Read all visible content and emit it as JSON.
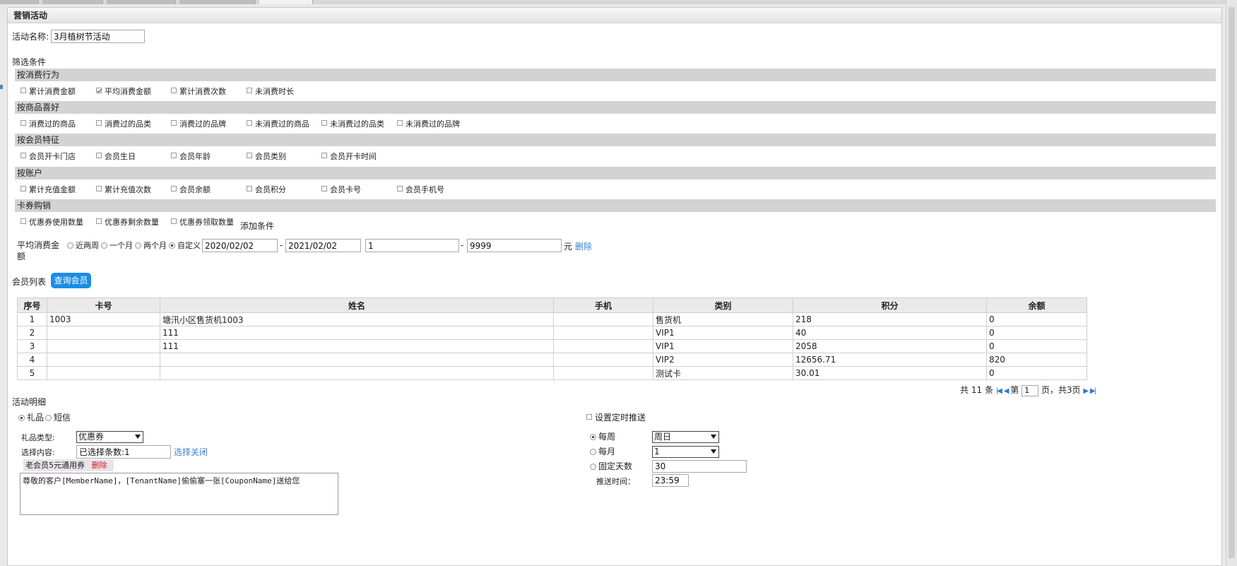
{
  "panel_title": "营销活动",
  "activity_name": {
    "label": "活动名称:",
    "value": "3月植树节活动"
  },
  "filter_title": "筛选条件",
  "sections": [
    {
      "title": "按消费行为",
      "options": [
        {
          "label": "累计消费金额",
          "checked": false
        },
        {
          "label": "平均消费金额",
          "checked": true
        },
        {
          "label": "累计消费次数",
          "checked": false
        },
        {
          "label": "未消费时长",
          "checked": false
        }
      ]
    },
    {
      "title": "按商品喜好",
      "options": [
        {
          "label": "消费过的商品",
          "checked": false
        },
        {
          "label": "消费过的品类",
          "checked": false
        },
        {
          "label": "消费过的品牌",
          "checked": false
        },
        {
          "label": "未消费过的商品",
          "checked": false
        },
        {
          "label": "未消费过的品类",
          "checked": false
        },
        {
          "label": "未消费过的品牌",
          "checked": false
        }
      ]
    },
    {
      "title": "按会员特征",
      "options": [
        {
          "label": "会员开卡门店",
          "checked": false
        },
        {
          "label": "会员生日",
          "checked": false
        },
        {
          "label": "会员年龄",
          "checked": false
        },
        {
          "label": "会员类别",
          "checked": false
        },
        {
          "label": "会员开卡时间",
          "checked": false
        }
      ]
    },
    {
      "title": "按账户",
      "options": [
        {
          "label": "累计充值金额",
          "checked": false
        },
        {
          "label": "累计充值次数",
          "checked": false
        },
        {
          "label": "会员余额",
          "checked": false
        },
        {
          "label": "会员积分",
          "checked": false
        },
        {
          "label": "会员卡号",
          "checked": false
        },
        {
          "label": "会员手机号",
          "checked": false
        }
      ]
    },
    {
      "title": "卡券购销",
      "options": [
        {
          "label": "优惠券使用数量",
          "checked": false
        },
        {
          "label": "优惠券剩余数量",
          "checked": false
        },
        {
          "label": "优惠券领取数量",
          "checked": false
        }
      ]
    }
  ],
  "add_condition": "添加条件",
  "condition": {
    "label": "平均消费金额",
    "periods": [
      {
        "label": "近两周",
        "checked": false
      },
      {
        "label": "一个月",
        "checked": false
      },
      {
        "label": "两个月",
        "checked": false
      },
      {
        "label": "自定义",
        "checked": true
      }
    ],
    "date_from": "2020/02/02",
    "date_sep": "-",
    "date_to": "2021/02/02",
    "amount_from": "1",
    "amount_sep": "-",
    "amount_to": "9999",
    "unit": "元",
    "delete": "删除"
  },
  "member_list": {
    "label": "会员列表",
    "query_button": "查询会员"
  },
  "table": {
    "headers": [
      "序号",
      "卡号",
      "姓名",
      "手机",
      "类别",
      "积分",
      "余额"
    ],
    "rows": [
      [
        "1",
        "1003",
        "塘汛小区售货机1003",
        "",
        "售货机",
        "218",
        "0"
      ],
      [
        "2",
        "",
        "111",
        "",
        "VIP1",
        "40",
        "0"
      ],
      [
        "3",
        "",
        "111",
        "",
        "VIP1",
        "2058",
        "0"
      ],
      [
        "4",
        "",
        "",
        "",
        "VIP2",
        "12656.71",
        "820"
      ],
      [
        "5",
        "",
        "",
        "",
        "测试卡",
        "30.01",
        "0"
      ]
    ]
  },
  "pager": {
    "total_prefix": "共",
    "total": "11",
    "total_suffix": "条",
    "page_prefix": "第",
    "page": "1",
    "page_suffix": "页，共3页"
  },
  "detail": {
    "title": "活动明细",
    "type_options": [
      {
        "label": "礼品",
        "checked": true
      },
      {
        "label": "短信",
        "checked": false
      }
    ],
    "gift_type_label": "礼品类型:",
    "gift_type_value": "优惠券",
    "select_content_label": "选择内容:",
    "select_content_value": "已选择条数:1",
    "select_link": "选择",
    "close_link": "关闭",
    "coupon_name": "老会员5元通用券",
    "coupon_delete": "删除",
    "message": "尊敬的客户[MemberName]，[TenantName]偷偷塞一张[CouponName]送给您"
  },
  "schedule": {
    "toggle_label": "设置定时推送",
    "weekly": {
      "label": "每周",
      "checked": true,
      "value": "周日"
    },
    "monthly": {
      "label": "每月",
      "checked": false,
      "value": "1"
    },
    "fixed": {
      "label": "固定天数",
      "checked": false,
      "value": "30"
    },
    "time_label": "推送时间：",
    "time_value": "23:59"
  }
}
